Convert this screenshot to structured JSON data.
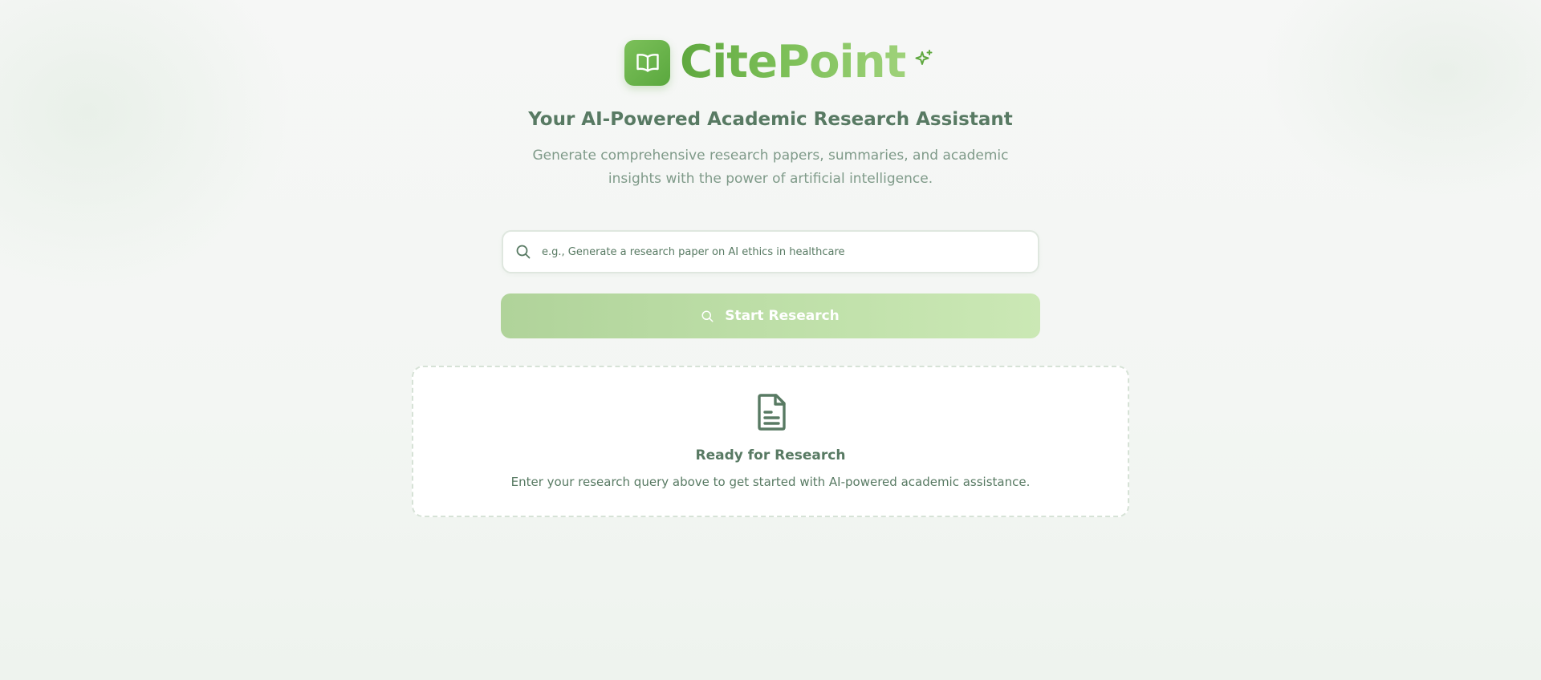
{
  "brand": {
    "name": "CitePoint",
    "logo_icon": "open-book-icon",
    "decoration_icon": "sparkle-icon",
    "colors": {
      "primary": "#5fa83f",
      "accent": "#9fd27a",
      "text": "#587a63"
    }
  },
  "hero": {
    "tagline": "Your AI-Powered Academic Research Assistant",
    "description": "Generate comprehensive research papers, summaries, and academic insights with the power of artificial intelligence."
  },
  "search": {
    "icon": "search-icon",
    "value": "",
    "placeholder": "e.g., Generate a research paper on AI ethics in healthcare"
  },
  "actions": {
    "start_label": "Start Research",
    "start_icon": "search-icon",
    "start_disabled": true
  },
  "empty_state": {
    "icon": "document-icon",
    "title": "Ready for Research",
    "description": "Enter your research query above to get started with AI-powered academic assistance."
  }
}
